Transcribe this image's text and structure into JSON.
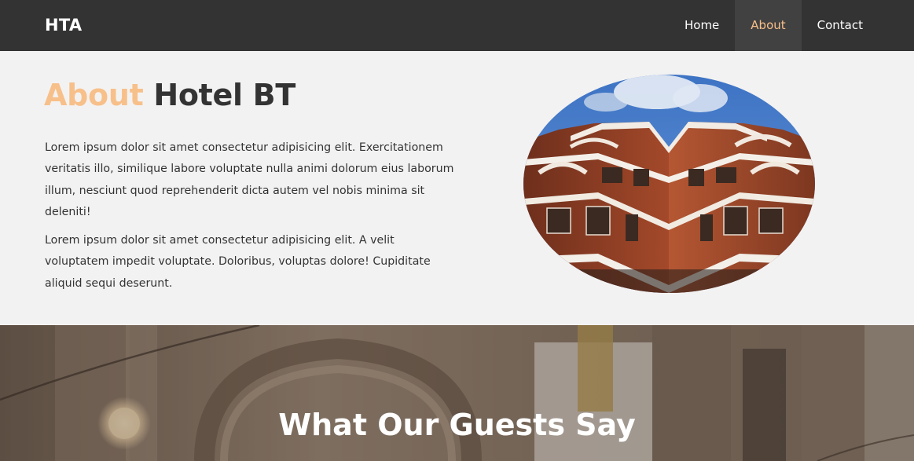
{
  "navbar": {
    "brand": "HTA",
    "items": [
      {
        "label": "Home"
      },
      {
        "label": "About"
      },
      {
        "label": "Contact"
      }
    ]
  },
  "about": {
    "title_accent": "About",
    "title_rest": "Hotel BT",
    "paragraphs": [
      "Lorem ipsum dolor sit amet consectetur adipisicing elit. Exercitationem veritatis illo, similique labore voluptate nulla animi dolorum eius laborum illum, nesciunt quod reprehenderit dicta autem vel nobis minima sit deleniti!",
      "Lorem ipsum dolor sit amet consectetur adipisicing elit. A velit voluptatem impedit voluptate. Doloribus, voluptas dolore! Cupiditate aliquid sequi deserunt."
    ]
  },
  "testimonials": {
    "title": "What Our Guests Say"
  },
  "colors": {
    "navbar_bg": "#333333",
    "active_nav_bg": "#424141",
    "accent": "#f7c08a",
    "section_bg": "#f3f2f2"
  }
}
